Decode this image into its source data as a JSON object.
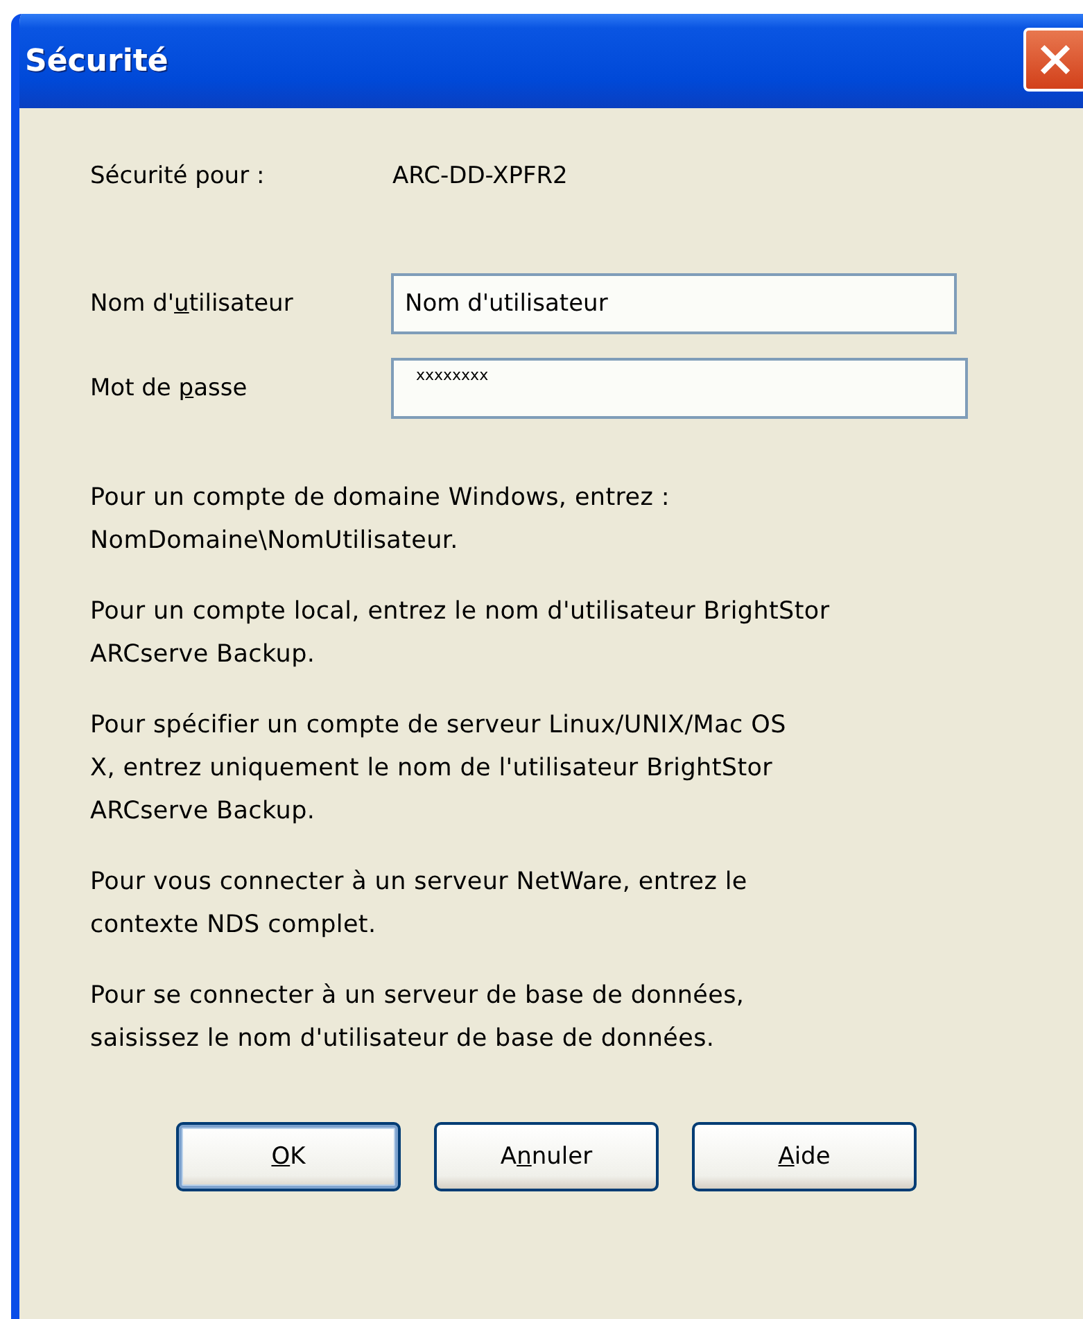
{
  "window": {
    "title": "Sécurité"
  },
  "target": {
    "label": "Sécurité pour :",
    "value": "ARC-DD-XPFR2"
  },
  "fields": [
    {
      "label_parts": [
        "Nom d'",
        "u",
        "tilisateur"
      ],
      "value": "Nom d'utilisateur",
      "kind": "text"
    },
    {
      "label_parts": [
        "Mot de ",
        "p",
        "asse"
      ],
      "value": "xxxxxxxx",
      "kind": "password"
    }
  ],
  "paragraphs": [
    {
      "lines": [
        "Pour un compte de domaine Windows, entrez :",
        "NomDomaine\\NomUtilisateur."
      ]
    },
    {
      "lines": [
        "Pour un compte local, entrez le nom d'utilisateur BrightStor",
        "ARCserve Backup."
      ]
    },
    {
      "lines": [
        "Pour spécifier un compte de serveur Linux/UNIX/Mac OS",
        "X, entrez uniquement le nom de l'utilisateur BrightStor",
        "ARCserve Backup."
      ]
    },
    {
      "lines": [
        "Pour vous connecter à un serveur NetWare, entrez le",
        "contexte NDS complet."
      ]
    },
    {
      "lines": [
        "Pour se connecter à un serveur de base de données,",
        "saisissez le nom d'utilisateur de base de données."
      ]
    }
  ],
  "buttons": [
    {
      "access_key": "O",
      "after": "K",
      "default": true
    },
    {
      "before": "A",
      "access_key": "n",
      "after": "nuler",
      "default": false
    },
    {
      "access_key": "A",
      "after": "ide",
      "default": false
    }
  ]
}
